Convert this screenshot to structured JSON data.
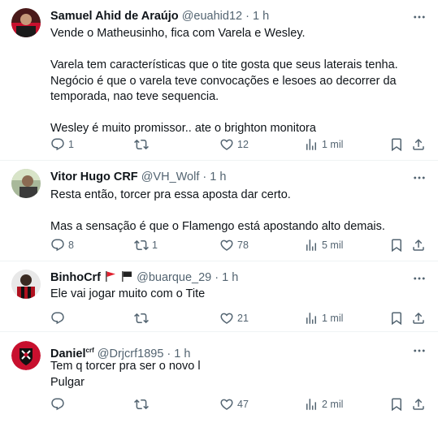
{
  "tweets": [
    {
      "name": "Samuel Ahid de Araújo",
      "handle": "@euahid12",
      "time": "1 h",
      "text": "Vende o Matheusinho, fica com Varela e Wesley.\n\nVarela tem características que o tite gosta que seus laterais tenha. Negócio é que o varela teve convocações e lesoes ao decorrer da temporada, nao teve sequencia.\n\nWesley é muito promissor.. ate o brighton monitora",
      "replies": "1",
      "retweets": "",
      "likes": "12",
      "views": "1 mil"
    },
    {
      "name": "Vitor Hugo CRF",
      "handle": "@VH_Wolf",
      "time": "1 h",
      "text": "Resta então, torcer pra essa aposta dar certo.\n\nMas a sensação é que o Flamengo está apostando alto demais.",
      "replies": "8",
      "retweets": "1",
      "likes": "78",
      "views": "5 mil"
    },
    {
      "name": "BinhoCrf",
      "handle": "@buarque_29",
      "time": "1 h",
      "text": "Ele vai jogar muito com o Tite",
      "replies": "",
      "retweets": "",
      "likes": "21",
      "views": "1 mil"
    },
    {
      "name": "Daniel",
      "name_sup": "crf",
      "handle": "@Drjcrf1895",
      "time": "1 h",
      "text": "Tem q torcer pra ser o novo l\nPulgar",
      "replies": "",
      "retweets": "",
      "likes": "47",
      "views": "2 mil"
    }
  ],
  "separator": "·",
  "icons": {
    "reply": "reply-icon",
    "retweet": "retweet-icon",
    "like": "heart-icon",
    "views": "views-icon",
    "bookmark": "bookmark-icon",
    "share": "share-icon",
    "more": "more-icon"
  },
  "colors": {
    "text": "#0f1419",
    "muted": "#536471",
    "border": "#eff3f4",
    "flamengo_red": "#d11a1a"
  }
}
